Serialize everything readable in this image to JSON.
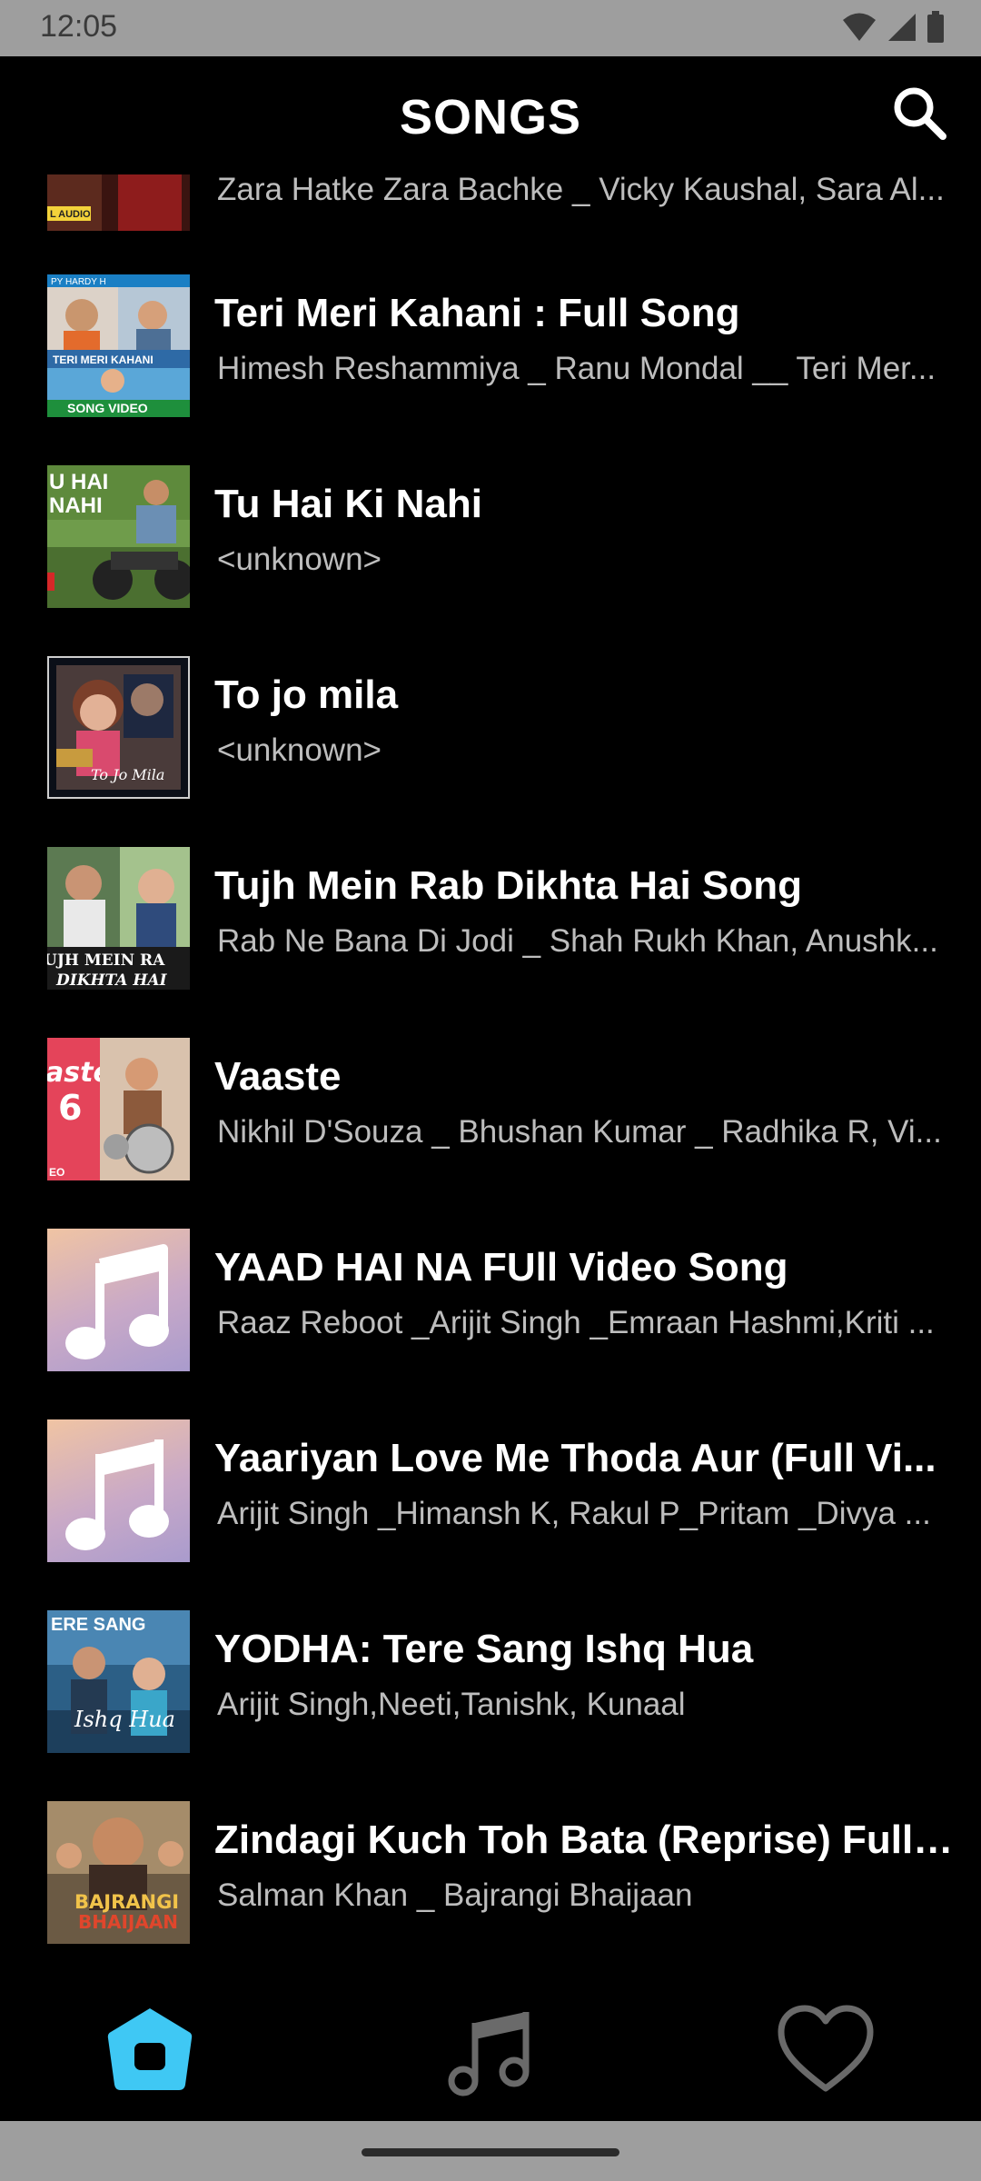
{
  "status_bar": {
    "time": "12:05",
    "icons": [
      "wifi-icon",
      "cell-signal-icon",
      "battery-icon"
    ]
  },
  "header": {
    "title": "SONGS",
    "search_icon": "search-icon"
  },
  "songs": [
    {
      "title": "",
      "artist": "Zara Hatke Zara Bachke _ Vicky Kaushal, Sara Al...",
      "thumb": "poster"
    },
    {
      "title": "Teri Meri Kahani : Full Song",
      "artist": "Himesh Reshammiya _ Ranu Mondal __ Teri Mer...",
      "thumb": "poster"
    },
    {
      "title": "Tu Hai Ki Nahi",
      "artist": "<unknown>",
      "thumb": "poster"
    },
    {
      "title": "To jo mila",
      "artist": "<unknown>",
      "thumb": "poster"
    },
    {
      "title": "Tujh Mein Rab Dikhta Hai Song",
      "artist": "Rab Ne Bana Di Jodi _ Shah Rukh Khan, Anushk...",
      "thumb": "poster"
    },
    {
      "title": "Vaaste",
      "artist": "Nikhil D'Souza _ Bhushan Kumar _ Radhika R, Vi...",
      "thumb": "poster"
    },
    {
      "title": "YAAD HAI NA  FUll Video Song",
      "artist": "Raaz Reboot _Arijit Singh _Emraan Hashmi,Kriti ...",
      "thumb": "music-note"
    },
    {
      "title": "Yaariyan Love Me Thoda Aur (Full Vi...",
      "artist": "Arijit Singh _Himansh K, Rakul P_Pritam _Divya ...",
      "thumb": "music-note"
    },
    {
      "title": "YODHA: Tere Sang Ishq Hua",
      "artist": "Arijit Singh,Neeti,Tanishk, Kunaal",
      "thumb": "poster"
    },
    {
      "title": "Zindagi Kuch Toh Bata (Reprise) Full ...",
      "artist": "Salman Khan _ Bajrangi Bhaijaan",
      "thumb": "poster"
    }
  ],
  "thumb_text": {
    "zara_hatke": "L AUDIO",
    "teri_meri": "SONG VIDEO",
    "teri_meri_top": "PY    HARDY    H",
    "teri_meri_mid": "TERI MERI KAHANI",
    "tu_hai": "U HAI\nNAHI",
    "to_jo_mila": "To Jo Mila",
    "tujh_mein": "TUJH MEIN RA\nDIKHTA HAI",
    "vaaste": "aste",
    "vaaste_num": "6",
    "vaaste_sub": "EO",
    "yodha": "ERE SANG",
    "yodha_script": "Ishq Hua",
    "bajrangi": "BAJRANGI\nBHAIJAAN"
  },
  "bottom_nav": {
    "items": [
      {
        "name": "home",
        "icon": "home-icon",
        "active": true
      },
      {
        "name": "player",
        "icon": "music-note-icon",
        "active": false
      },
      {
        "name": "favorites",
        "icon": "heart-icon",
        "active": false
      }
    ],
    "active_color": "#3fc8f4"
  },
  "colors": {
    "background": "#000000",
    "title_text": "#ffffff",
    "subtitle_text": "#bdbdbd",
    "system_bars": "#9e9e9e"
  }
}
